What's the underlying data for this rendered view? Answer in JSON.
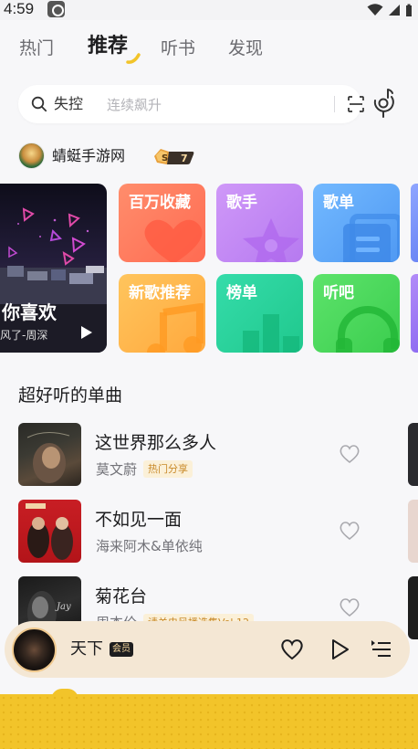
{
  "status_bar": {
    "time": "4:59"
  },
  "top_tabs": [
    {
      "label": "热门"
    },
    {
      "label": "推荐"
    },
    {
      "label": "听书"
    },
    {
      "label": "发现"
    }
  ],
  "search": {
    "keyword": "失控",
    "hint": "连续飙升"
  },
  "user": {
    "name": "蜻蜓手游网",
    "level": "S",
    "level_number": "7"
  },
  "hero": {
    "title": "你喜欢",
    "subtitle": "风了-周深"
  },
  "tiles": [
    {
      "label": "百万收藏",
      "color_from": "#ff8a6a",
      "color_to": "#ff6a4e"
    },
    {
      "label": "歌手",
      "color_from": "#c890f6",
      "color_to": "#b57af0"
    },
    {
      "label": "歌单",
      "color_from": "#6ab4ff",
      "color_to": "#4d98f2"
    },
    {
      "label": "新歌推荐",
      "color_from": "#ffc05a",
      "color_to": "#ffa63c"
    },
    {
      "label": "榜单",
      "color_from": "#30d9a5",
      "color_to": "#22c98f"
    },
    {
      "label": "听吧",
      "color_from": "#58e067",
      "color_to": "#3acd4d"
    }
  ],
  "section": {
    "title": "超好听的单曲"
  },
  "songs": [
    {
      "title": "这世界那么多人",
      "artist": "莫文蔚",
      "tag": "热门分享"
    },
    {
      "title": "不如见一面",
      "artist": "海来阿木&单依纯",
      "tag": ""
    },
    {
      "title": "菊花台",
      "artist": "周杰伦",
      "tag": "请关电风播选集Vol.12"
    }
  ],
  "mini_player": {
    "title": "天下",
    "badge": "会员"
  },
  "colors": {
    "accent": "#f2c42a",
    "player_bg": "#f4e7d4"
  }
}
